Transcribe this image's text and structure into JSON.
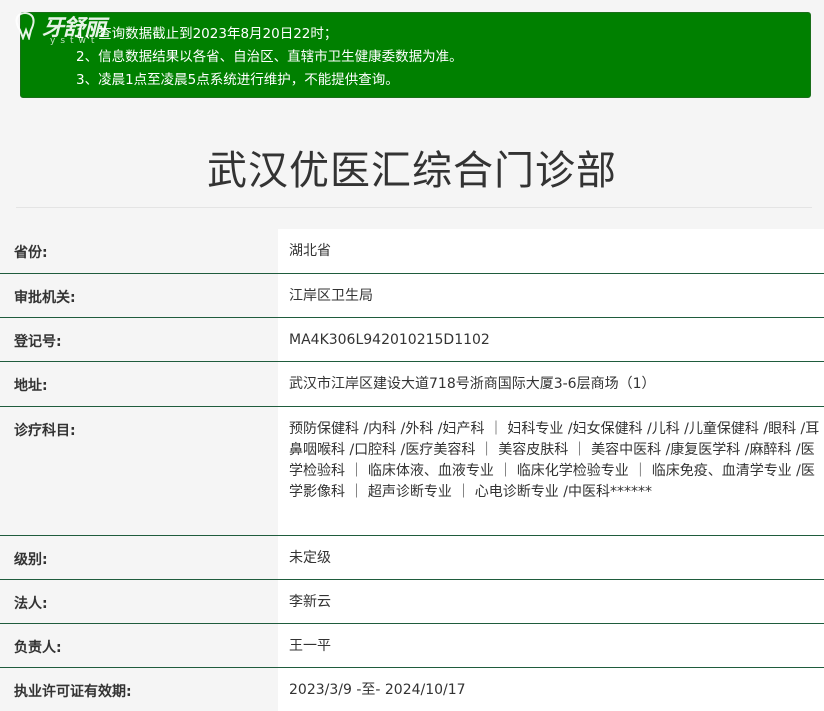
{
  "logo": {
    "cn": "牙舒丽",
    "en": "ystwt"
  },
  "notice": {
    "lines": [
      "1、查询数据截止到2023年8月20日22时；",
      "2、信息数据结果以各省、自治区、直辖市卫生健康委数据为准。",
      "3、凌晨1点至凌晨5点系统进行维护，不能提供查询。"
    ]
  },
  "title": "武汉优医汇综合门诊部",
  "rows": [
    {
      "label": "省份:",
      "value": "湖北省"
    },
    {
      "label": "审批机关:",
      "value": "江岸区卫生局"
    },
    {
      "label": "登记号:",
      "value": "MA4K306L942010215D1102"
    },
    {
      "label": "地址:",
      "value": "武汉市江岸区建设大道718号浙商国际大厦3-6层商场（1）"
    },
    {
      "label": "诊疗科目:",
      "value": "预防保健科 /内科 /外科 /妇产科 ｜ 妇科专业 /妇女保健科 /儿科 /儿童保健科 /眼科 /耳鼻咽喉科 /口腔科 /医疗美容科 ｜ 美容皮肤科 ｜ 美容中医科 /康复医学科 /麻醉科 /医学检验科 ｜ 临床体液、血液专业 ｜ 临床化学检验专业 ｜ 临床免疫、血清学专业 /医学影像科 ｜ 超声诊断专业 ｜ 心电诊断专业 /中医科******"
    },
    {
      "label": "级别:",
      "value": "未定级"
    },
    {
      "label": "法人:",
      "value": "李新云"
    },
    {
      "label": "负责人:",
      "value": "王一平"
    },
    {
      "label": "执业许可证有效期:",
      "value": "2023/3/9 -至- 2024/10/17"
    }
  ]
}
